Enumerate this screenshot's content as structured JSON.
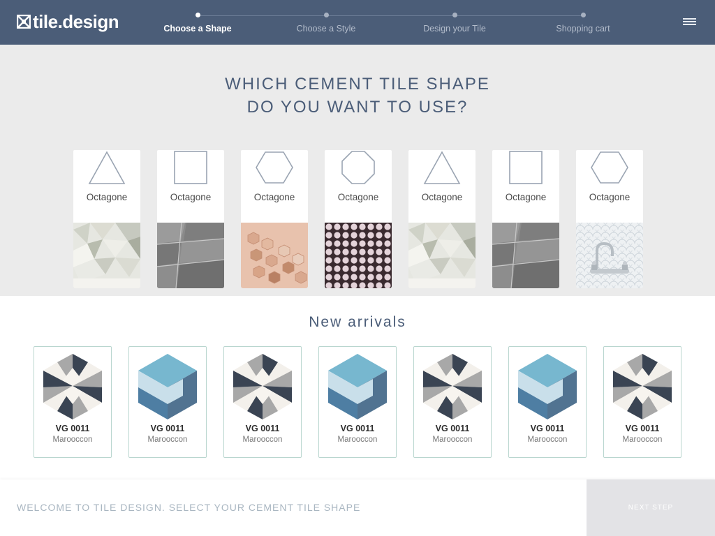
{
  "header": {
    "logo": "tile.design",
    "steps": [
      {
        "label": "Choose a Shape"
      },
      {
        "label": "Choose a Style"
      },
      {
        "label": "Design your Tile"
      },
      {
        "label": "Shopping cart"
      }
    ],
    "active_step": 0
  },
  "shapes": {
    "heading_line1": "WHICH CEMENT TILE SHAPE",
    "heading_line2": "DO YOU WANT TO USE?",
    "items": [
      {
        "label": "Octagone",
        "icon": "triangle-icon",
        "photo": "triangle-tiles-photo"
      },
      {
        "label": "Octagone",
        "icon": "square-icon",
        "photo": "grey-square-tiles-photo"
      },
      {
        "label": "Octagone",
        "icon": "hexagon-icon",
        "photo": "copper-hexagon-tiles-photo"
      },
      {
        "label": "Octagone",
        "icon": "octagon-icon",
        "photo": "penny-round-tiles-photo"
      },
      {
        "label": "Octagone",
        "icon": "triangle-icon",
        "photo": "triangle-tiles-photo"
      },
      {
        "label": "Octagone",
        "icon": "square-icon",
        "photo": "grey-square-tiles-photo"
      },
      {
        "label": "Octagone",
        "icon": "hexagon-icon",
        "photo": "fish-scale-faucet-photo"
      }
    ]
  },
  "arrivals": {
    "title": "New arrivals",
    "items": [
      {
        "code": "VG 0011",
        "subtitle": "Marooccon",
        "pattern": "star-hexagon-tile"
      },
      {
        "code": "VG 0011",
        "subtitle": "Marooccon",
        "pattern": "blue-cube-tile"
      },
      {
        "code": "VG 0011",
        "subtitle": "Marooccon",
        "pattern": "star-hexagon-tile"
      },
      {
        "code": "VG 0011",
        "subtitle": "Marooccon",
        "pattern": "blue-cube-tile"
      },
      {
        "code": "VG 0011",
        "subtitle": "Marooccon",
        "pattern": "star-hexagon-tile"
      },
      {
        "code": "VG 0011",
        "subtitle": "Marooccon",
        "pattern": "blue-cube-tile"
      },
      {
        "code": "VG 0011",
        "subtitle": "Marooccon",
        "pattern": "star-hexagon-tile"
      }
    ]
  },
  "footer": {
    "message": "WELCOME TO TILE DESIGN. SELECT YOUR CEMENT TILE SHAPE",
    "next_label": "NEXT STEP"
  },
  "colors": {
    "header_bg": "#4b5d78",
    "section_bg": "#ebebeb",
    "accent_border": "#b9d6cf",
    "heading_text": "#4b5d78"
  }
}
